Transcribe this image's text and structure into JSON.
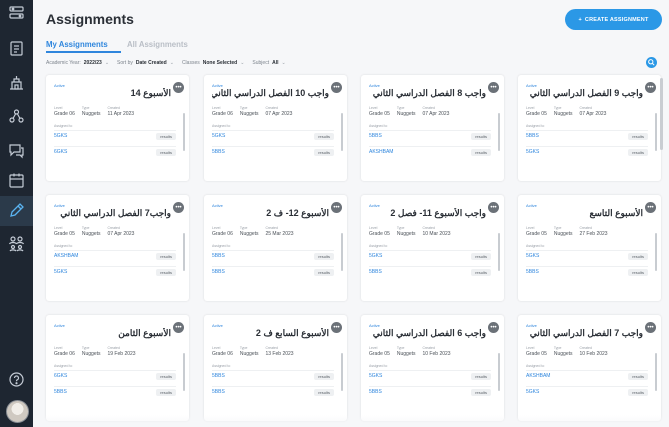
{
  "header": {
    "title": "Assignments",
    "create_label": "CREATE ASSIGNMENT",
    "create_plus": "+"
  },
  "tabs": [
    {
      "label": "My Assignments"
    },
    {
      "label": "All Assignments"
    }
  ],
  "filters": {
    "year_label": "Academic Year:",
    "year_value": "2022/23",
    "sort_label": "Sort by",
    "sort_value": "Date Created",
    "classes_label": "Classes",
    "classes_value": "None Selected",
    "subject_label": "Subject",
    "subject_value": "All",
    "caret": "⌄"
  },
  "card_labels": {
    "status": "Active",
    "level": "Level",
    "type": "Type",
    "created": "Created",
    "assigned": "Assigned to",
    "results": "results",
    "more": "•••"
  },
  "cards": [
    {
      "title": "الأسبوع 14",
      "level": "Grade 06",
      "type": "Nuggets",
      "created": "11 Apr 2023",
      "class1": "5GKS",
      "class2": "6GKS"
    },
    {
      "title": "واجب 10 الفصل الدراسي الثاني",
      "level": "Grade 06",
      "type": "Nuggets",
      "created": "07 Apr 2023",
      "class1": "5GKS",
      "class2": "5BBS"
    },
    {
      "title": "واجب 8 الفصل الدراسي الثاني",
      "level": "Grade 05",
      "type": "Nuggets",
      "created": "07 Apr 2023",
      "class1": "5BBS",
      "class2": "AKSHBAM"
    },
    {
      "title": "واجب 9 الفصل الدراسي الثاني",
      "level": "Grade 05",
      "type": "Nuggets",
      "created": "07 Apr 2023",
      "class1": "5BBS",
      "class2": "5GKS"
    },
    {
      "title": "واجب7 الفصل الدراسي الثاني",
      "level": "Grade 05",
      "type": "Nuggets",
      "created": "07 Apr 2023",
      "class1": "AKSHBAM",
      "class2": "5GKS"
    },
    {
      "title": "الأسبوع 12- ف 2",
      "level": "Grade 06",
      "type": "Nuggets",
      "created": "25 Mar 2023",
      "class1": "5BBS",
      "class2": "5BBS"
    },
    {
      "title": "واجب الأسبوع 11- فصل 2",
      "level": "Grade 05",
      "type": "Nuggets",
      "created": "10 Mar 2023",
      "class1": "5GKS",
      "class2": "5BBS"
    },
    {
      "title": "الأسبوع التاسع",
      "level": "Grade 05",
      "type": "Nuggets",
      "created": "27 Feb 2023",
      "class1": "5GKS",
      "class2": "5BBS"
    },
    {
      "title": "الأسبوع الثامن",
      "level": "Grade 06",
      "type": "Nuggets",
      "created": "19 Feb 2023",
      "class1": "6GKS",
      "class2": "5BBS"
    },
    {
      "title": "الأسبوع السابع ف 2",
      "level": "Grade 06",
      "type": "Nuggets",
      "created": "13 Feb 2023",
      "class1": "5BBS",
      "class2": "5BBS"
    },
    {
      "title": "واجب 6 الفصل الدراسي الثاني",
      "level": "Grade 05",
      "type": "Nuggets",
      "created": "10 Feb 2023",
      "class1": "5GKS",
      "class2": "5BBS"
    },
    {
      "title": "واجب 7 الفصل الدراسي الثاني",
      "level": "Grade 05",
      "type": "Nuggets",
      "created": "10 Feb 2023",
      "class1": "AKSHBAM",
      "class2": "5GKS"
    }
  ],
  "sidebar_icons": [
    "dashboard-icon",
    "document-icon",
    "building-icon",
    "connections-icon",
    "chat-icon",
    "calendar-icon",
    "assignment-pen-icon",
    "users-icon",
    "help-icon"
  ],
  "colors": {
    "accent": "#2b98e6",
    "sidebar": "#1e2631",
    "link": "#2f86dd"
  }
}
